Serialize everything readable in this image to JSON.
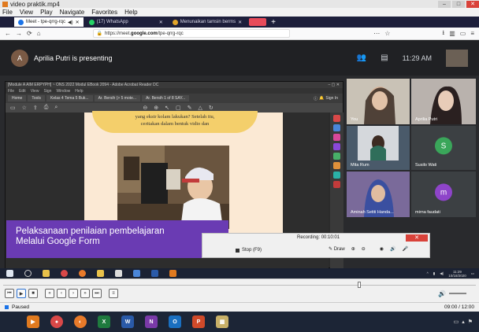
{
  "player": {
    "title": "video praktik.mp4",
    "menu": [
      "File",
      "View",
      "Play",
      "Navigate",
      "Favorites",
      "Help"
    ],
    "status": "Paused",
    "time": "09:00 / 12:00",
    "controls": [
      "prev",
      "play",
      "stop",
      "rewind",
      "back",
      "forward",
      "fast-forward",
      "next"
    ]
  },
  "browser": {
    "tabs": [
      {
        "label": "Meet - tpe-qrrg-rqc",
        "icon_color": "#1a73e8"
      },
      {
        "label": "(17) WhatsApp",
        "icon_color": "#25d366"
      },
      {
        "label": "Menunaikan tamsin berms",
        "icon_color": "#e2a52a"
      }
    ],
    "new_tab": "+",
    "url_prefix": "https://meet.",
    "url_domain": "google.com",
    "url_suffix": "/tpe-qrrg-rqc"
  },
  "meet": {
    "presenter_initial": "A",
    "presenting": "Aprilia Putri is presenting",
    "clock": "11:29 AM",
    "participants": [
      {
        "name": "You",
        "kind": "video",
        "bg": "#c9c2b6"
      },
      {
        "name": "Aprilia Putri",
        "kind": "video",
        "bg": "#b9b2ad"
      },
      {
        "name": "Mita Rum",
        "kind": "video",
        "bg": "#4a5a6a"
      },
      {
        "name": "Susilo Wati",
        "kind": "avatar",
        "initial": "S",
        "color": "#3aa65a"
      },
      {
        "name": "Aminah Setiti Handa...",
        "kind": "video",
        "bg": "#6b5a8a"
      },
      {
        "name": "mirna faudati",
        "kind": "avatar",
        "initial": "m",
        "color": "#8e44c9"
      }
    ]
  },
  "pdf": {
    "title": "[Module A AIM ERPYPH] ~ ONS 2022 Modul EBook 2094 - Adobe Acrobat Reader DC",
    "menu": [
      "File",
      "Edit",
      "View",
      "Sign",
      "Window",
      "Help"
    ],
    "tabs": [
      "Home",
      "Tools",
      "Kelas 4 Tema 5 Buk...",
      "Ar. Bersih (> 5 mote...",
      "Ar. Bersih 1 of 8 SAY..."
    ],
    "sign_in": "Sign In",
    "speech_line1": "yang ekstr kolam lakukan? Setelah itu,",
    "speech_line2": "ceritakan dalam bentuk vidio dan"
  },
  "banner": {
    "line1": "Pelaksanaan penilaian pembelajaran",
    "line2": "Melalui Google Form"
  },
  "recorder": {
    "label": "Recording:",
    "time": "00:10:01",
    "stop": "Stop (F9)",
    "draw": "Draw"
  },
  "recorded_tray": {
    "time": "11:29",
    "date": "10/18/2020"
  }
}
